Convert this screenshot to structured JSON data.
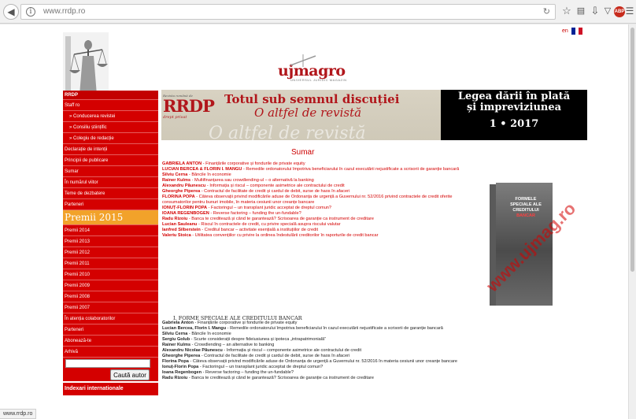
{
  "browser": {
    "url": "www.rrdp.ro",
    "status_url": "www.rrdp.ro",
    "icons": [
      "back-icon",
      "info-icon",
      "reload-icon",
      "star-icon",
      "reading-list-icon",
      "download-icon",
      "pocket-icon",
      "adblock-icon",
      "menu-icon"
    ],
    "adblock_label": "ABP"
  },
  "header": {
    "brand_main": "ujmagro",
    "brand_sub": "UNIVERSUL JURIDIC MAGAZIN",
    "lang": "en",
    "flag_colors": [
      "#002395",
      "#fcd116",
      "#ce1126"
    ]
  },
  "sidebar": {
    "title": "RRDP",
    "items_top": [
      {
        "label": "Staff ro",
        "sub": false
      },
      {
        "label": "» Conducerea revistei",
        "sub": true
      },
      {
        "label": "» Consiliu științific",
        "sub": true
      },
      {
        "label": "» Colegiu de redacție",
        "sub": true
      },
      {
        "label": "Declarație de intenții",
        "sub": false
      },
      {
        "label": "Principii de publicare",
        "sub": false
      },
      {
        "label": "Sumar",
        "sub": false
      },
      {
        "label": "În numărul viitor",
        "sub": false
      },
      {
        "label": "Teme de dezbatere",
        "sub": false
      },
      {
        "label": "Parteneri",
        "sub": false
      }
    ],
    "award_heading": "Premii 2015",
    "items_bottom": [
      "Premii 2014",
      "Premii 2013",
      "Premii 2012",
      "Premii 2011",
      "Premii 2010",
      "Premii 2009",
      "Premii 2008",
      "Premii 2007",
      "În atenția colaboratorilor",
      "Parteneri",
      "Abonează-te",
      "Arhivă"
    ],
    "search_value": "",
    "search_button": "Caută autor",
    "footer": "Indexari internationale"
  },
  "banner": {
    "logo_small": "Revista română de",
    "logo_big": "RRDP",
    "logo_sub": "drept privat",
    "line1": "Totul sub semnul discuției",
    "line2": "O altfel de revistă",
    "ghost": "O altfel de revistă",
    "right1": "Legea dării în plată",
    "right2": "și impreviziunea",
    "right3": "1 • 2017"
  },
  "summary": {
    "title": "Sumar",
    "entries": [
      {
        "author": "GABRIELA ANTON",
        "text": " - Finanțările corporative și fondurile de private equity"
      },
      {
        "author": "LUCIAN BERCEA & FLORIN I. MANGU",
        "text": " - Remedile ordonatorului împotriva beneficiarului în cazul executării nejustificate a scrisorii de garanție bancară"
      },
      {
        "author": "Silviu Cerna",
        "text": " - Băncile în economie"
      },
      {
        "author": "Rainer Kulms",
        "text": " - Multifinanțarea sau crowdlending-ul – o alternativă la banking"
      },
      {
        "author": "Alexandru Păunescu",
        "text": " - Informația și riscul – componente asimetrice ale contractului de credit"
      },
      {
        "author": "Gheorghe Piperea",
        "text": " - Contractul de facilitate de credit și cardul de debit, surse de haos în afaceri"
      },
      {
        "author": "FLORINA POPA",
        "text": " - Câteva observații privind modificările aduse de Ordonanța de urgență a Guvernului nr. 52/2016 privind contractele de credit oferite consumatorilor pentru bunuri imobile, în materia cesiunii unor creanțe bancare"
      },
      {
        "author": "IONUȚ-FLORIN POPA",
        "text": " - Factoringul – un transplant juridic acceptat de dreptul comun?"
      },
      {
        "author": "IOANA REGENBOGEN",
        "text": " - Reverse factoring – funding the un-fundable?"
      },
      {
        "author": "Radu Rizoiu",
        "text": " - Banca te creditează și când te garantează? Scrisoarea de garanție ca instrument de creditare"
      },
      {
        "author": "Lucian Sauleanu",
        "text": " - Riscul în contractele de credit, cu privire specială asupra riscului valutar"
      },
      {
        "author": "Ianfred Silberstein",
        "text": " - Creditul bancar – activitate esențială a instituțiilor de credit"
      },
      {
        "author": "Valeriu Stoica",
        "text": " - Utilitatea convențiilor cu privire la ordinea îndestulării creditorilor în raporturile de credit bancar"
      }
    ]
  },
  "section": {
    "title": "I. FORME SPECIALE ALE CREDITULUI BANCAR",
    "entries": [
      {
        "author": "Gabriela Anton",
        "text": " - Finanțările corporative și fondurile de private equity"
      },
      {
        "author": "Lucian Bercea, Florin I. Mangu",
        "text": " - Remedile ordonatorului împotriva beneficiarului în cazul executării nejustificate a scrisorii de garanție bancară"
      },
      {
        "author": "Silviu Cerna",
        "text": " - Băncile în economie"
      },
      {
        "author": "Sergiu Golub",
        "text": " - Scurte considerații despre fideiusiunea și ipoteca „intrapatrimonială”"
      },
      {
        "author": "Rainer Kulms",
        "text": " - Crowdlending – an alternative to banking"
      },
      {
        "author": "Alexandru Nicolae Păunescu",
        "text": " - Informația și riscul – componente asimetrice ale contractului de credit"
      },
      {
        "author": "Gheorghe Piperea",
        "text": " - Contractul de facilitate de credit și cardul de debit, surse de haos în afaceri"
      },
      {
        "author": "Florina Popa",
        "text": " - Câteva observații privind modificările aduse de Ordonanța de urgență a Guvernului nr. 52/2016 în materia cesiunii unor creanțe bancare"
      },
      {
        "author": "Ionuț-Florin Popa",
        "text": " - Factoringul – un transplant juridic acceptat de dreptul comun?"
      },
      {
        "author": "Ioana Regenbogen",
        "text": " - Reverse factoring – funding the un-fundable?"
      },
      {
        "author": "Radu Rizoiu",
        "text": " - Banca te creditează și când te garantează? Scrisoarea de garanție ca instrument de creditare"
      }
    ]
  },
  "book": {
    "line1": "FORMELE",
    "line2": "SPECIALE ALE",
    "line3": "CREDITULUI",
    "line4": "BANCAR",
    "watermark": "www.ujmag.ro"
  }
}
